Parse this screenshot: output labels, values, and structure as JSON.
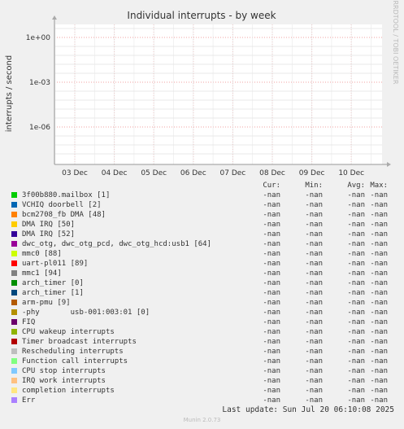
{
  "chart_data": {
    "type": "line",
    "title": "Individual interrupts - by week",
    "ylabel": "interrupts / second",
    "side_label": "RRDTOOL / TOBI OETIKER",
    "y_scale": "log",
    "y_ticks": [
      "1e+00",
      "1e-03",
      "1e-06"
    ],
    "x_ticks": [
      "03 Dec",
      "04 Dec",
      "05 Dec",
      "06 Dec",
      "07 Dec",
      "08 Dec",
      "09 Dec",
      "10 Dec"
    ],
    "grid": true,
    "columns": [
      "Cur:",
      "Min:",
      "Avg:",
      "Max:"
    ],
    "series": [
      {
        "name": "3f00b880.mailbox [1]",
        "color": "#00cc00",
        "cur": "-nan",
        "min": "-nan",
        "avg": "-nan",
        "max": "-nan"
      },
      {
        "name": "VCHIQ doorbell [2]",
        "color": "#0066b3",
        "cur": "-nan",
        "min": "-nan",
        "avg": "-nan",
        "max": "-nan"
      },
      {
        "name": "bcm2708_fb DMA [48]",
        "color": "#ff8000",
        "cur": "-nan",
        "min": "-nan",
        "avg": "-nan",
        "max": "-nan"
      },
      {
        "name": "DMA IRQ [50]",
        "color": "#ffcc00",
        "cur": "-nan",
        "min": "-nan",
        "avg": "-nan",
        "max": "-nan"
      },
      {
        "name": "DMA IRQ [52]",
        "color": "#330099",
        "cur": "-nan",
        "min": "-nan",
        "avg": "-nan",
        "max": "-nan"
      },
      {
        "name": "dwc_otg, dwc_otg_pcd, dwc_otg_hcd:usb1 [64]",
        "color": "#990099",
        "cur": "-nan",
        "min": "-nan",
        "avg": "-nan",
        "max": "-nan"
      },
      {
        "name": "mmc0 [88]",
        "color": "#ccff00",
        "cur": "-nan",
        "min": "-nan",
        "avg": "-nan",
        "max": "-nan"
      },
      {
        "name": "uart-pl011 [89]",
        "color": "#ff0000",
        "cur": "-nan",
        "min": "-nan",
        "avg": "-nan",
        "max": "-nan"
      },
      {
        "name": "mmc1 [94]",
        "color": "#808080",
        "cur": "-nan",
        "min": "-nan",
        "avg": "-nan",
        "max": "-nan"
      },
      {
        "name": "arch_timer [0]",
        "color": "#008f00",
        "cur": "-nan",
        "min": "-nan",
        "avg": "-nan",
        "max": "-nan"
      },
      {
        "name": "arch_timer [1]",
        "color": "#00487d",
        "cur": "-nan",
        "min": "-nan",
        "avg": "-nan",
        "max": "-nan"
      },
      {
        "name": "arm-pmu [9]",
        "color": "#b35a00",
        "cur": "-nan",
        "min": "-nan",
        "avg": "-nan",
        "max": "-nan"
      },
      {
        "name": "-phy       usb-001:003:01 [0]",
        "color": "#b38f00",
        "cur": "-nan",
        "min": "-nan",
        "avg": "-nan",
        "max": "-nan"
      },
      {
        "name": "FIQ",
        "color": "#6b006b",
        "cur": "-nan",
        "min": "-nan",
        "avg": "-nan",
        "max": "-nan"
      },
      {
        "name": "CPU wakeup interrupts",
        "color": "#8fb300",
        "cur": "-nan",
        "min": "-nan",
        "avg": "-nan",
        "max": "-nan"
      },
      {
        "name": "Timer broadcast interrupts",
        "color": "#b30000",
        "cur": "-nan",
        "min": "-nan",
        "avg": "-nan",
        "max": "-nan"
      },
      {
        "name": "Rescheduling interrupts",
        "color": "#bebebe",
        "cur": "-nan",
        "min": "-nan",
        "avg": "-nan",
        "max": "-nan"
      },
      {
        "name": "Function call interrupts",
        "color": "#80ff80",
        "cur": "-nan",
        "min": "-nan",
        "avg": "-nan",
        "max": "-nan"
      },
      {
        "name": "CPU stop interrupts",
        "color": "#80c9ff",
        "cur": "-nan",
        "min": "-nan",
        "avg": "-nan",
        "max": "-nan"
      },
      {
        "name": "IRQ work interrupts",
        "color": "#ffc080",
        "cur": "-nan",
        "min": "-nan",
        "avg": "-nan",
        "max": "-nan"
      },
      {
        "name": "completion interrupts",
        "color": "#ffe680",
        "cur": "-nan",
        "min": "-nan",
        "avg": "-nan",
        "max": "-nan"
      },
      {
        "name": "Err",
        "color": "#aa80ff",
        "cur": "-nan",
        "min": "-nan",
        "avg": "-nan",
        "max": "-nan"
      }
    ]
  },
  "footer": {
    "last_update": "Last update: Sun Jul 20 06:10:08 2025",
    "generator": "Munin 2.0.73"
  }
}
